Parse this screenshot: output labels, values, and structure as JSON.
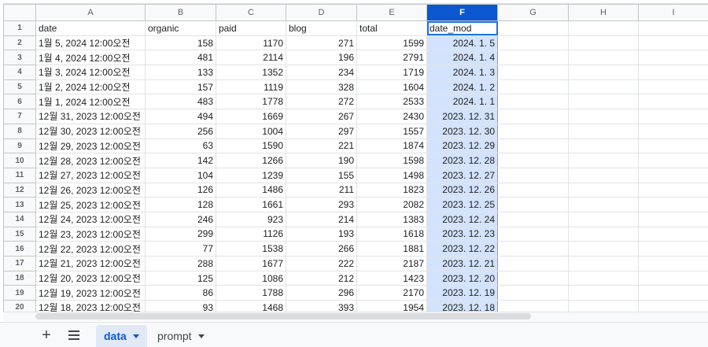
{
  "columns": [
    "A",
    "B",
    "C",
    "D",
    "E",
    "F",
    "G",
    "H",
    "I"
  ],
  "selected_column": "F",
  "row_numbers": [
    "1",
    "2",
    "3",
    "4",
    "5",
    "6",
    "7",
    "8",
    "9",
    "10",
    "11",
    "12",
    "13",
    "14",
    "15",
    "16",
    "17",
    "18",
    "19",
    "20"
  ],
  "header_row": [
    "date",
    "organic",
    "paid",
    "blog",
    "total",
    "date_mod"
  ],
  "rows": [
    [
      "1월 5, 2024 12:00오전",
      "158",
      "1170",
      "271",
      "1599",
      "2024. 1. 5"
    ],
    [
      "1월 4, 2024 12:00오전",
      "481",
      "2114",
      "196",
      "2791",
      "2024. 1. 4"
    ],
    [
      "1월 3, 2024 12:00오전",
      "133",
      "1352",
      "234",
      "1719",
      "2024. 1. 3"
    ],
    [
      "1월 2, 2024 12:00오전",
      "157",
      "1119",
      "328",
      "1604",
      "2024. 1. 2"
    ],
    [
      "1월 1, 2024 12:00오전",
      "483",
      "1778",
      "272",
      "2533",
      "2024. 1. 1"
    ],
    [
      "12월 31, 2023 12:00오전",
      "494",
      "1669",
      "267",
      "2430",
      "2023. 12. 31"
    ],
    [
      "12월 30, 2023 12:00오전",
      "256",
      "1004",
      "297",
      "1557",
      "2023. 12. 30"
    ],
    [
      "12월 29, 2023 12:00오전",
      "63",
      "1590",
      "221",
      "1874",
      "2023. 12. 29"
    ],
    [
      "12월 28, 2023 12:00오전",
      "142",
      "1266",
      "190",
      "1598",
      "2023. 12. 28"
    ],
    [
      "12월 27, 2023 12:00오전",
      "104",
      "1239",
      "155",
      "1498",
      "2023. 12. 27"
    ],
    [
      "12월 26, 2023 12:00오전",
      "126",
      "1486",
      "211",
      "1823",
      "2023. 12. 26"
    ],
    [
      "12월 25, 2023 12:00오전",
      "128",
      "1661",
      "293",
      "2082",
      "2023. 12. 25"
    ],
    [
      "12월 24, 2023 12:00오전",
      "246",
      "923",
      "214",
      "1383",
      "2023. 12. 24"
    ],
    [
      "12월 23, 2023 12:00오전",
      "299",
      "1126",
      "193",
      "1618",
      "2023. 12. 23"
    ],
    [
      "12월 22, 2023 12:00오전",
      "77",
      "1538",
      "266",
      "1881",
      "2023. 12. 22"
    ],
    [
      "12월 21, 2023 12:00오전",
      "288",
      "1677",
      "222",
      "2187",
      "2023. 12. 21"
    ],
    [
      "12월 20, 2023 12:00오전",
      "125",
      "1086",
      "212",
      "1423",
      "2023. 12. 20"
    ],
    [
      "12월 19, 2023 12:00오전",
      "86",
      "1788",
      "296",
      "2170",
      "2023. 12. 19"
    ],
    [
      "12월 18, 2023 12:00오전",
      "93",
      "1468",
      "393",
      "1954",
      "2023. 12. 18"
    ]
  ],
  "tabs": [
    {
      "label": "data",
      "active": true
    },
    {
      "label": "prompt",
      "active": false
    }
  ],
  "icons": {
    "add_sheet": "plus-icon",
    "all_sheets": "menu-lines-icon"
  },
  "colors": {
    "accent": "#0b57d0",
    "selected_column_fill": "#d3e3fd",
    "active_tab_fill": "#e1e9f7"
  }
}
